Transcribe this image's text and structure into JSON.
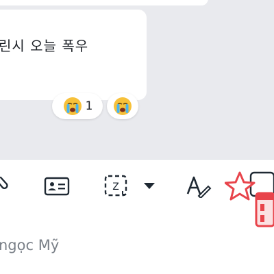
{
  "message": {
    "text": "린시 오늘 폭우",
    "reactions": [
      {
        "emoji_icon": "crying-face-emoji-icon",
        "count": "1"
      },
      {
        "emoji_icon": "crying-face-emoji-icon",
        "count": ""
      }
    ]
  },
  "toolbar": {
    "items": [
      {
        "icon": "paperclip-icon"
      },
      {
        "icon": "contact-card-icon"
      },
      {
        "icon": "screenshot-crop-icon"
      },
      {
        "icon": "chevron-down-icon"
      },
      {
        "icon": "text-format-icon"
      },
      {
        "icon": "sticker-icon"
      }
    ]
  },
  "input": {
    "placeholder": "ngọc Mỹ"
  },
  "colors": {
    "icon": "#1f2933",
    "sticker_red": "#e8444b",
    "background": "#e9eaee"
  }
}
